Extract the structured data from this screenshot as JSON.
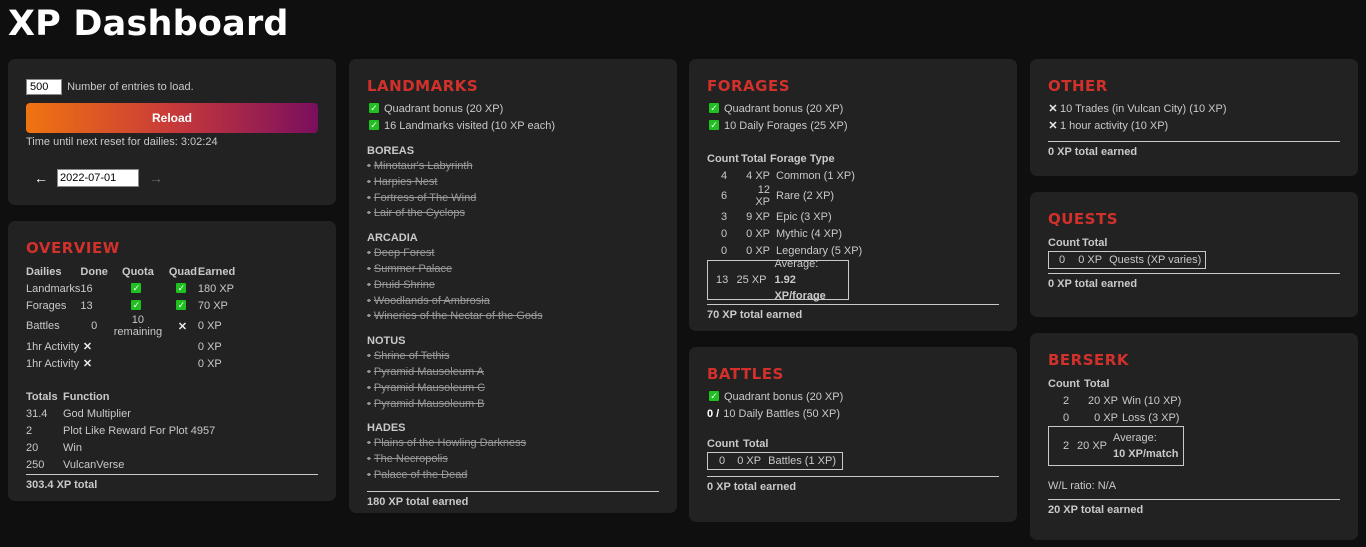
{
  "title": "XP Dashboard",
  "controls": {
    "entries_value": "500",
    "entries_label": "Number of entries to load.",
    "reload_label": "Reload",
    "reset_text": "Time until next reset for dailies: 3:02:24",
    "prev_arrow": "←",
    "next_arrow": "→",
    "date_value": "2022-07-01"
  },
  "overview": {
    "title": "OVERVIEW",
    "headers": [
      "Dailies",
      "Done",
      "Quota",
      "Quad",
      "Earned"
    ],
    "rows": [
      {
        "name": "Landmarks",
        "done": "16",
        "quota": "check",
        "quad": "check",
        "earned": "180 XP"
      },
      {
        "name": "Forages",
        "done": "13",
        "quota": "check",
        "quad": "check",
        "earned": "70 XP"
      },
      {
        "name": "Battles",
        "done": "0",
        "quota": "10 remaining",
        "quad": "x",
        "earned": "0 XP"
      },
      {
        "name": "1hr Activity",
        "done": "x",
        "quota": "",
        "quad": "",
        "earned": "0 XP"
      },
      {
        "name": "1hr Activity",
        "done": "x",
        "quota": "",
        "quad": "",
        "earned": "0 XP"
      }
    ],
    "totals_headers": [
      "Totals",
      "Function"
    ],
    "totals_rows": [
      {
        "total": "31.4",
        "function": "God Multiplier"
      },
      {
        "total": "2",
        "function": "Plot Like Reward For Plot 4957"
      },
      {
        "total": "20",
        "function": "Win"
      },
      {
        "total": "250",
        "function": "VulcanVerse"
      }
    ],
    "grand_total": "303.4 XP total"
  },
  "landmarks": {
    "title": "LANDMARKS",
    "checks": [
      "Quadrant bonus (20 XP)",
      "16 Landmarks visited (10 XP each)"
    ],
    "regions": [
      {
        "name": "BOREAS",
        "items": [
          "Minotaur's Labyrinth",
          "Harpies Nest",
          "Fortress of The Wind",
          "Lair of the Cyclops"
        ]
      },
      {
        "name": "ARCADIA",
        "items": [
          "Deep Forest",
          "Summer Palace",
          "Druid Shrine",
          "Woodlands of Ambrosia",
          "Wineries of the Nectar of the Gods"
        ]
      },
      {
        "name": "NOTUS",
        "items": [
          "Shrine of Tethis",
          "Pyramid Mausoleum A",
          "Pyramid Mausoleum C",
          "Pyramid Mausoleum B"
        ]
      },
      {
        "name": "HADES",
        "items": [
          "Plains of the Howling Darkness",
          "The Necropolis",
          "Palace of the Dead"
        ]
      }
    ],
    "bullet": "•",
    "total": "180 XP total earned"
  },
  "forages": {
    "title": "FORAGES",
    "checks": [
      "Quadrant bonus (20 XP)",
      "10 Daily Forages (25 XP)"
    ],
    "headers": [
      "Count",
      "Total",
      "Forage Type"
    ],
    "rows": [
      {
        "count": "4",
        "total": "4 XP",
        "type": "Common (1 XP)"
      },
      {
        "count": "6",
        "total": "12 XP",
        "type": "Rare (2 XP)"
      },
      {
        "count": "3",
        "total": "9 XP",
        "type": "Epic (3 XP)"
      },
      {
        "count": "0",
        "total": "0 XP",
        "type": "Mythic (4 XP)"
      },
      {
        "count": "0",
        "total": "0 XP",
        "type": "Legendary (5 XP)"
      }
    ],
    "sum_count": "13",
    "sum_total": "25 XP",
    "average_label": "Average:",
    "average_value": "1.92 XP/forage",
    "total": "70 XP total earned"
  },
  "battles": {
    "title": "BATTLES",
    "check": "Quadrant bonus (20 XP)",
    "progress_prefix": "0 /",
    "progress_text": "10 Daily Battles (50 XP)",
    "headers": [
      "Count",
      "Total"
    ],
    "row": {
      "count": "0",
      "total": "0 XP",
      "type": "Battles (1 XP)"
    },
    "total": "0 XP total earned"
  },
  "other": {
    "title": "OTHER",
    "items": [
      "10 Trades (in Vulcan City) (10 XP)",
      "1 hour activity (10 XP)"
    ],
    "total": "0 XP total earned"
  },
  "quests": {
    "title": "QUESTS",
    "headers": [
      "Count",
      "Total"
    ],
    "row": {
      "count": "0",
      "total": "0 XP",
      "type": "Quests (XP varies)"
    },
    "total": "0 XP total earned"
  },
  "berserk": {
    "title": "BERSERK",
    "headers": [
      "Count",
      "Total"
    ],
    "rows": [
      {
        "count": "2",
        "total": "20 XP",
        "type": "Win (10 XP)"
      },
      {
        "count": "0",
        "total": "0 XP",
        "type": "Loss (3 XP)"
      }
    ],
    "sum_count": "2",
    "sum_total": "20 XP",
    "average_label": "Average:",
    "average_value": "10 XP/match",
    "wl_ratio": "W/L ratio: N/A",
    "total": "20 XP total earned"
  },
  "colors": {
    "accent_red": "#d2312b",
    "check_green": "#20c020",
    "card_bg": "#222223",
    "page_bg": "#0f0f0f"
  }
}
